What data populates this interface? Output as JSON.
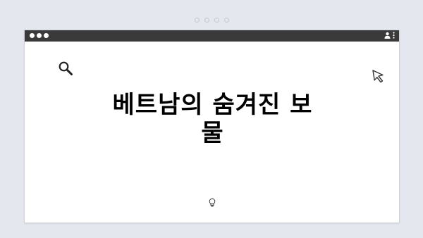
{
  "headline": "베트남의 숨겨진 보물",
  "icons": {
    "window_controls": "traffic-light-dots",
    "user": "user-icon",
    "menu": "kebab-icon",
    "search": "search-icon",
    "cursor": "cursor-icon",
    "idea": "lightbulb-icon"
  },
  "colors": {
    "background": "#e4e8ee",
    "titlebar": "#3a3a3a",
    "window": "#ffffff",
    "text": "#000000"
  }
}
